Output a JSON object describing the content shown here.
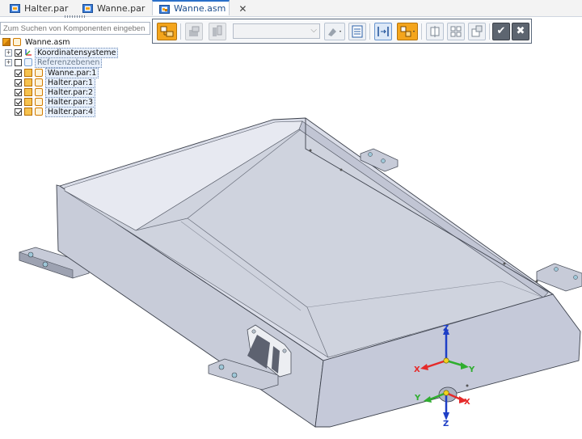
{
  "tabs": [
    {
      "label": "Halter.par",
      "icon": "part-file-icon",
      "active": false
    },
    {
      "label": "Wanne.par",
      "icon": "part-file-icon",
      "active": false
    },
    {
      "label": "Wanne.asm",
      "icon": "assembly-file-icon",
      "active": true,
      "close": "✕"
    }
  ],
  "search": {
    "placeholder": "Zum Suchen von Komponenten eingeben"
  },
  "tree": {
    "root": "Wanne.asm",
    "items": [
      {
        "label": "Koordinatensysteme",
        "checked": true,
        "expandable": true
      },
      {
        "label": "Referenzebenen",
        "checked": false,
        "expandable": true
      },
      {
        "label": "Wanne.par:1",
        "checked": true
      },
      {
        "label": "Halter.par:1",
        "checked": true
      },
      {
        "label": "Halter.par:2",
        "checked": true
      },
      {
        "label": "Halter.par:3",
        "checked": true
      },
      {
        "label": "Halter.par:4",
        "checked": true
      }
    ]
  },
  "toolbar": {
    "accept_glyph": "✔",
    "cancel_glyph": "✖",
    "combo_value": ""
  },
  "axes_top": {
    "z": "Z",
    "x": "X",
    "y": "Y"
  },
  "axes_bottom": {
    "z": "Z",
    "x": "X",
    "y": "Y"
  },
  "colors": {
    "accent": "#2a6fc9",
    "tray_face": "#c4c9d6",
    "tray_inner": "#d6d9e4",
    "x_axis": "#e52a2a",
    "y_axis": "#2fae2f",
    "z_axis": "#1e3fc6",
    "origin": "#f2d21d"
  }
}
